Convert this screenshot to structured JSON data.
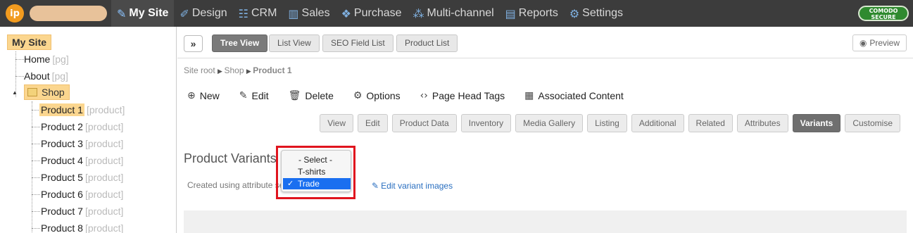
{
  "topnav": {
    "logo_text": "ip",
    "items": [
      {
        "label": "My Site",
        "icon": "edit-icon",
        "glyph": "✎"
      },
      {
        "label": "Design",
        "icon": "brush-icon",
        "glyph": "✐"
      },
      {
        "label": "CRM",
        "icon": "contacts-icon",
        "glyph": "☷"
      },
      {
        "label": "Sales",
        "icon": "bar-chart-icon",
        "glyph": "▥"
      },
      {
        "label": "Purchase",
        "icon": "tag-icon",
        "glyph": "❖"
      },
      {
        "label": "Multi-channel",
        "icon": "network-icon",
        "glyph": "⁂"
      },
      {
        "label": "Reports",
        "icon": "reports-icon",
        "glyph": "▤"
      },
      {
        "label": "Settings",
        "icon": "gear-icon",
        "glyph": "⚙"
      }
    ],
    "comodo_line1": "COMODO",
    "comodo_line2": "SECURE"
  },
  "tree": {
    "root": "My Site",
    "home": "Home",
    "home_tag": "[pg]",
    "about": "About",
    "about_tag": "[pg]",
    "shop": "Shop",
    "products": [
      {
        "label": "Product 1",
        "tag": "[product]"
      },
      {
        "label": "Product 2",
        "tag": "[product]"
      },
      {
        "label": "Product 3",
        "tag": "[product]"
      },
      {
        "label": "Product 4",
        "tag": "[product]"
      },
      {
        "label": "Product 5",
        "tag": "[product]"
      },
      {
        "label": "Product 6",
        "tag": "[product]"
      },
      {
        "label": "Product 7",
        "tag": "[product]"
      },
      {
        "label": "Product 8",
        "tag": "[product]"
      }
    ]
  },
  "toolbar": {
    "expand_glyph": "»",
    "views": [
      "Tree View",
      "List View",
      "SEO Field List",
      "Product List"
    ],
    "preview": "Preview"
  },
  "breadcrumb": {
    "root": "Site root",
    "shop": "Shop",
    "current": "Product 1"
  },
  "actions": [
    {
      "label": "New",
      "glyph": "⊕"
    },
    {
      "label": "Edit",
      "glyph": "✎"
    },
    {
      "label": "Delete",
      "glyph": "🗑"
    },
    {
      "label": "Options",
      "glyph": "⚙"
    },
    {
      "label": "Page Head Tags",
      "glyph": "‹›"
    },
    {
      "label": "Associated Content",
      "glyph": "▦"
    }
  ],
  "tabs": [
    "View",
    "Edit",
    "Product Data",
    "Inventory",
    "Media Gallery",
    "Listing",
    "Additional",
    "Related",
    "Attributes",
    "Variants",
    "Customise"
  ],
  "variants": {
    "heading": "Product Variants",
    "created_text": "Created using attribute se",
    "edit_images": "Edit variant images",
    "dropdown_options": [
      "- Select -",
      "T-shirts",
      "Trade"
    ],
    "selected": "Trade"
  },
  "colors": {
    "accent": "#1a6ff0",
    "highlight": "#e0141e",
    "tree_selected": "#fbd68f"
  }
}
